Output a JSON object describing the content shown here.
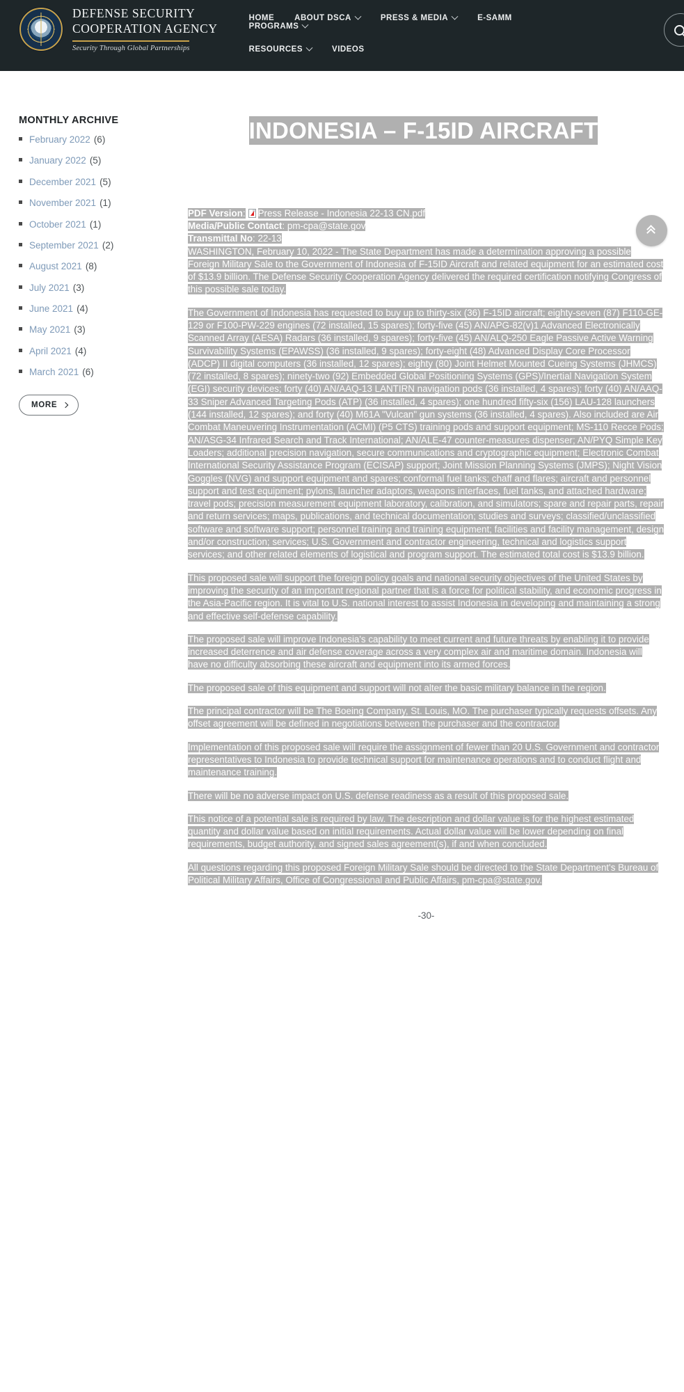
{
  "header": {
    "brand": {
      "line1": "DEFENSE SECURITY",
      "line2": "COOPERATION AGENCY",
      "tagline": "Security Through Global Partnerships"
    },
    "nav_row1": [
      {
        "label": "HOME",
        "has_caret": false
      },
      {
        "label": "ABOUT DSCA",
        "has_caret": true
      },
      {
        "label": "PRESS & MEDIA",
        "has_caret": true
      },
      {
        "label": "E-SAMM",
        "has_caret": false
      },
      {
        "label": "PROGRAMS",
        "has_caret": true
      }
    ],
    "nav_row2": [
      {
        "label": "RESOURCES",
        "has_caret": true
      },
      {
        "label": "VIDEOS",
        "has_caret": false
      }
    ],
    "search_label": "Search",
    "bg_color": "#1e2629",
    "accent_color": "#c8a24a"
  },
  "sidebar": {
    "title": "MONTHLY ARCHIVE",
    "items": [
      {
        "label": "February 2022",
        "count": "(6)"
      },
      {
        "label": "January 2022",
        "count": "(5)"
      },
      {
        "label": "December 2021",
        "count": "(5)"
      },
      {
        "label": "November 2021",
        "count": "(1)"
      },
      {
        "label": "October 2021",
        "count": "(1)"
      },
      {
        "label": "September 2021",
        "count": "(2)"
      },
      {
        "label": "August 2021",
        "count": "(8)"
      },
      {
        "label": "July 2021",
        "count": "(3)"
      },
      {
        "label": "June 2021",
        "count": "(4)"
      },
      {
        "label": "May 2021",
        "count": "(3)"
      },
      {
        "label": "April 2021",
        "count": "(4)"
      },
      {
        "label": "March 2021",
        "count": "(6)"
      }
    ],
    "more_label": "MORE",
    "link_color": "#7e9ab8"
  },
  "main": {
    "title": "INDONESIA – F-15ID AIRCRAFT",
    "selection_color": "#b0b0b0",
    "meta": {
      "pdf_label": "PDF Version",
      "pdf_filename": "Press Release - Indonesia 22-13 CN.pdf",
      "contact_label": "Media/Public Contact",
      "contact_value": "pm-cpa@state.gov",
      "transmittal_label": "Transmittal No",
      "transmittal_value": "22-13"
    },
    "paragraphs": [
      "WASHINGTON, February 10, 2022 - The State Department has made a determination approving a possible Foreign Military Sale to the Government of Indonesia of F-15ID Aircraft and related equipment for an estimated cost of $13.9 billion. The Defense Security Cooperation Agency delivered the required certification notifying Congress of this possible sale today.",
      "The Government of Indonesia has requested to buy up to thirty-six (36) F-15ID aircraft; eighty-seven (87) F110-GE-129 or F100-PW-229 engines (72 installed, 15 spares); forty-five (45) AN/APG-82(v)1 Advanced Electronically Scanned Array (AESA) Radars (36 installed, 9 spares); forty-five (45) AN/ALQ-250 Eagle Passive Active Warning Survivability Systems (EPAWSS) (36 installed, 9 spares); forty-eight (48) Advanced Display Core Processor (ADCP) II digital computers (36 installed, 12 spares); eighty (80) Joint Helmet Mounted Cueing Systems (JHMCS) (72 installed, 8 spares); ninety-two (92) Embedded Global Positioning Systems (GPS)/Inertial Navigation System (EGI) security devices; forty (40) AN/AAQ-13 LANTIRN navigation pods (36 installed, 4 spares); forty (40) AN/AAQ-33 Sniper Advanced Targeting Pods (ATP) (36 installed, 4 spares); one hundred fifty-six (156) LAU-128 launchers (144 installed, 12 spares); and forty (40) M61A \"Vulcan\" gun systems (36 installed, 4 spares). Also included are Air Combat Maneuvering Instrumentation (ACMI) (P5 CTS) training pods and support equipment; MS-110 Recce Pods; AN/ASG-34 Infrared Search and Track International; AN/ALE-47 counter-measures dispenser; AN/PYQ Simple Key Loaders; additional precision navigation, secure communications and cryptographic equipment; Electronic Combat International Security Assistance Program (ECISAP) support; Joint Mission Planning Systems (JMPS); Night Vision Goggles (NVG) and support equipment and spares; conformal fuel tanks; chaff and flares; aircraft and personnel support and test equipment; pylons, launcher adaptors, weapons interfaces, fuel tanks, and attached hardware; travel pods; precision measurement equipment laboratory, calibration, and simulators; spare and repair parts, repair and return services; maps, publications, and technical documentation; studies and surveys; classified/unclassified software and software support; personnel training and training equipment; facilities and facility management, design and/or construction; services; U.S. Government and contractor engineering, technical and logistics support services; and other related elements of logistical and program support. The estimated total cost is $13.9 billion.",
      "This proposed sale will support the foreign policy goals and national security objectives of the United States by improving the security of an important regional partner that is a force for political stability, and economic progress in the Asia-Pacific region. It is vital to U.S. national interest to assist Indonesia in developing and maintaining a strong and effective self-defense capability.",
      "The proposed sale will improve Indonesia's capability to meet current and future threats by enabling it to provide increased deterrence and air defense coverage across a very complex air and maritime domain. Indonesia will have no difficulty absorbing these aircraft and equipment into its armed forces.",
      "The proposed sale of this equipment and support will not alter the basic military balance in the region.",
      "The principal contractor will be The Boeing Company, St. Louis, MO. The purchaser typically requests offsets. Any offset agreement will be defined in negotiations between the purchaser and the contractor.",
      "Implementation of this proposed sale will require the assignment of fewer than 20 U.S. Government and contractor representatives to Indonesia to provide technical support for maintenance operations and to conduct flight and maintenance training.",
      "There will be no adverse impact on U.S. defense readiness as a result of this proposed sale.",
      "This notice of a potential sale is required by law. The description and dollar value is for the highest estimated quantity and dollar value based on initial requirements. Actual dollar value will be lower depending on final requirements, budget authority, and signed sales agreement(s), if and when concluded.",
      "All questions regarding this proposed Foreign Military Sale should be directed to the State Department's Bureau of Political Military Affairs, Office of Congressional and Public Affairs, pm-cpa@state.gov."
    ],
    "end_mark": "-30-"
  },
  "scroll_top": {
    "label": "Back to top"
  }
}
